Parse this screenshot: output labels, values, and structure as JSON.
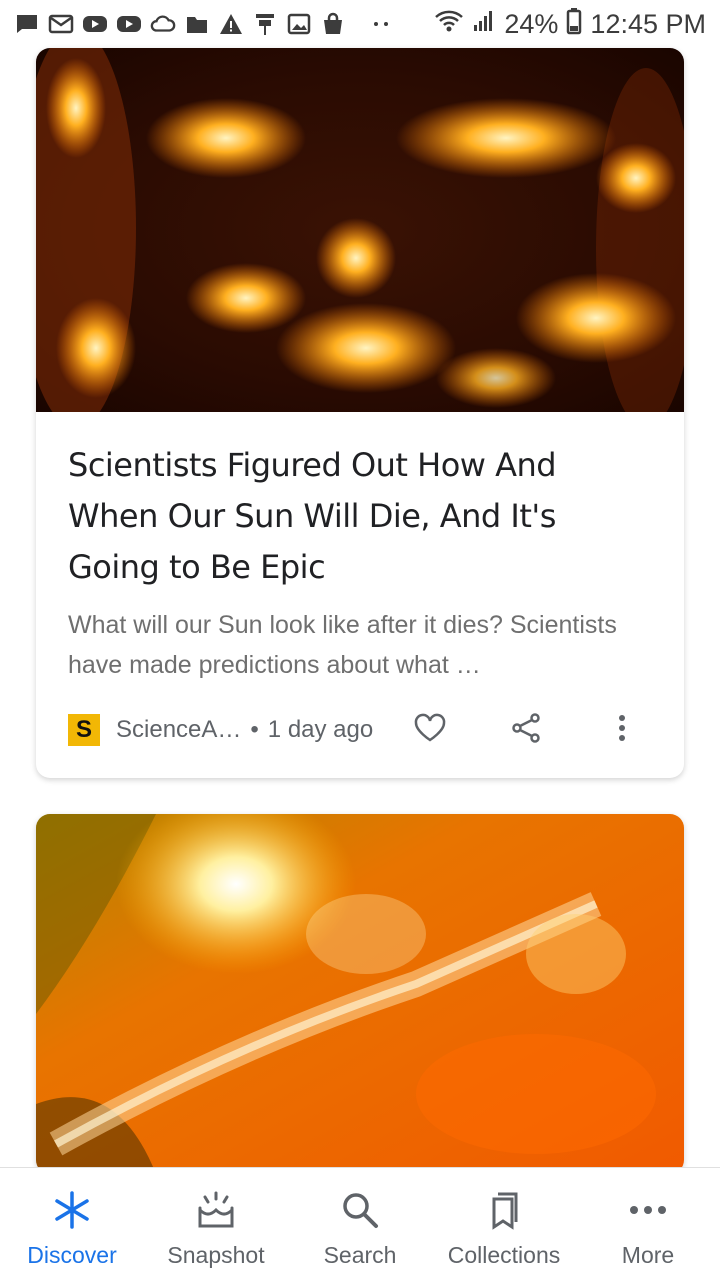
{
  "status_bar": {
    "battery": "24%",
    "time": "12:45 PM",
    "icons_left": [
      "message-icon",
      "email-icon",
      "youtube-icon",
      "youtube-icon",
      "cloud-icon",
      "folder-icon",
      "warning-icon",
      "pin-icon",
      "image-icon",
      "bag-icon",
      "more-dots-icon"
    ],
    "icons_right": [
      "wifi-icon",
      "signal-icon",
      "battery-icon"
    ]
  },
  "cards": [
    {
      "headline": "Scientists Figured Out How And When Our Sun Will Die, And It's Going to Be Epic",
      "snippet": "What will our Sun look like after it dies? Scientists have made predictions about what …",
      "publisher_initial": "S",
      "publisher": "ScienceA…",
      "separator": "•",
      "time": "1 day ago",
      "image": "sun-corona-image"
    },
    {
      "image": "solar-flare-image"
    }
  ],
  "bottom_nav": {
    "items": [
      {
        "label": "Discover",
        "icon": "asterisk-icon",
        "active": true
      },
      {
        "label": "Snapshot",
        "icon": "snapshot-icon",
        "active": false
      },
      {
        "label": "Search",
        "icon": "search-icon",
        "active": false
      },
      {
        "label": "Collections",
        "icon": "collections-icon",
        "active": false
      },
      {
        "label": "More",
        "icon": "more-icon",
        "active": false
      }
    ]
  },
  "colors": {
    "accent": "#1a73e8",
    "publisher_logo": "#f2b705",
    "headline": "#202124",
    "snippet": "#6f6f6f"
  }
}
